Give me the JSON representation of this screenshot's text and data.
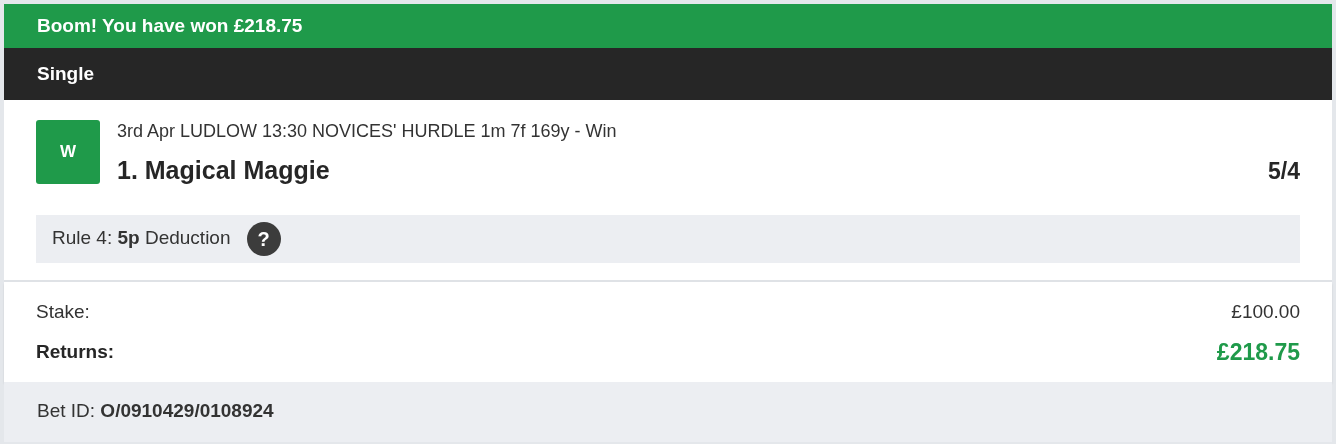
{
  "banner": {
    "text": "Boom! You have won £218.75"
  },
  "bet_type": "Single",
  "selection": {
    "result_badge": "W",
    "event": "3rd Apr LUDLOW 13:30 NOVICES' HURDLE 1m 7f 169y - Win",
    "runner": "1. Magical Maggie",
    "odds": "5/4"
  },
  "rule_notice": {
    "text": "Rule 4: **5p** Deduction",
    "help_icon": "?"
  },
  "summary": [
    {
      "label": "Stake:",
      "value": "£100.00",
      "kind": "plain"
    },
    {
      "label": "Returns:",
      "value": "£218.75",
      "kind": "total"
    }
  ],
  "footer": {
    "text": "Bet ID: **O/0910429/0108924**"
  }
}
